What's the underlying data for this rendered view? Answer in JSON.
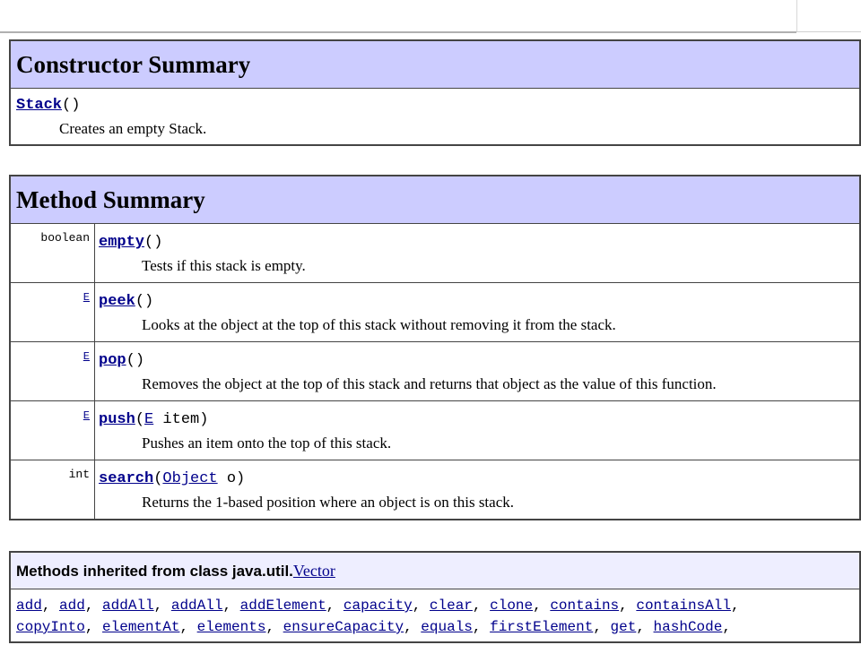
{
  "constructor_summary": {
    "title": "Constructor Summary",
    "items": [
      {
        "name": "Stack",
        "params": "()",
        "description": "Creates an empty Stack."
      }
    ]
  },
  "method_summary": {
    "title": "Method Summary",
    "rows": [
      {
        "type": "boolean",
        "type_is_link": false,
        "name": "empty",
        "sig_pre": "(",
        "sig_link": "",
        "sig_post": ")",
        "description": "Tests if this stack is empty."
      },
      {
        "type": "E",
        "type_is_link": true,
        "name": "peek",
        "sig_pre": "(",
        "sig_link": "",
        "sig_post": ")",
        "description": "Looks at the object at the top of this stack without removing it from the stack."
      },
      {
        "type": "E",
        "type_is_link": true,
        "name": "pop",
        "sig_pre": "(",
        "sig_link": "",
        "sig_post": ")",
        "description": "Removes the object at the top of this stack and returns that object as the value of this function."
      },
      {
        "type": "E",
        "type_is_link": true,
        "name": "push",
        "sig_pre": "(",
        "sig_link": "E",
        "sig_post": " item)",
        "description": "Pushes an item onto the top of this stack."
      },
      {
        "type": "int",
        "type_is_link": false,
        "name": "search",
        "sig_pre": "(",
        "sig_link": "Object",
        "sig_post": " o)",
        "description": "Returns the 1-based position where an object is on this stack."
      }
    ]
  },
  "inherited": {
    "title_prefix": "Methods inherited from class java.util.",
    "title_link": "Vector",
    "methods_line1": [
      "add",
      "add",
      "addAll",
      "addAll",
      "addElement",
      "capacity",
      "clear",
      "clone",
      "contains",
      "containsAll"
    ],
    "methods_line2": [
      "copyInto",
      "elementAt",
      "elements",
      "ensureCapacity",
      "equals",
      "firstElement",
      "get",
      "hashCode"
    ]
  }
}
